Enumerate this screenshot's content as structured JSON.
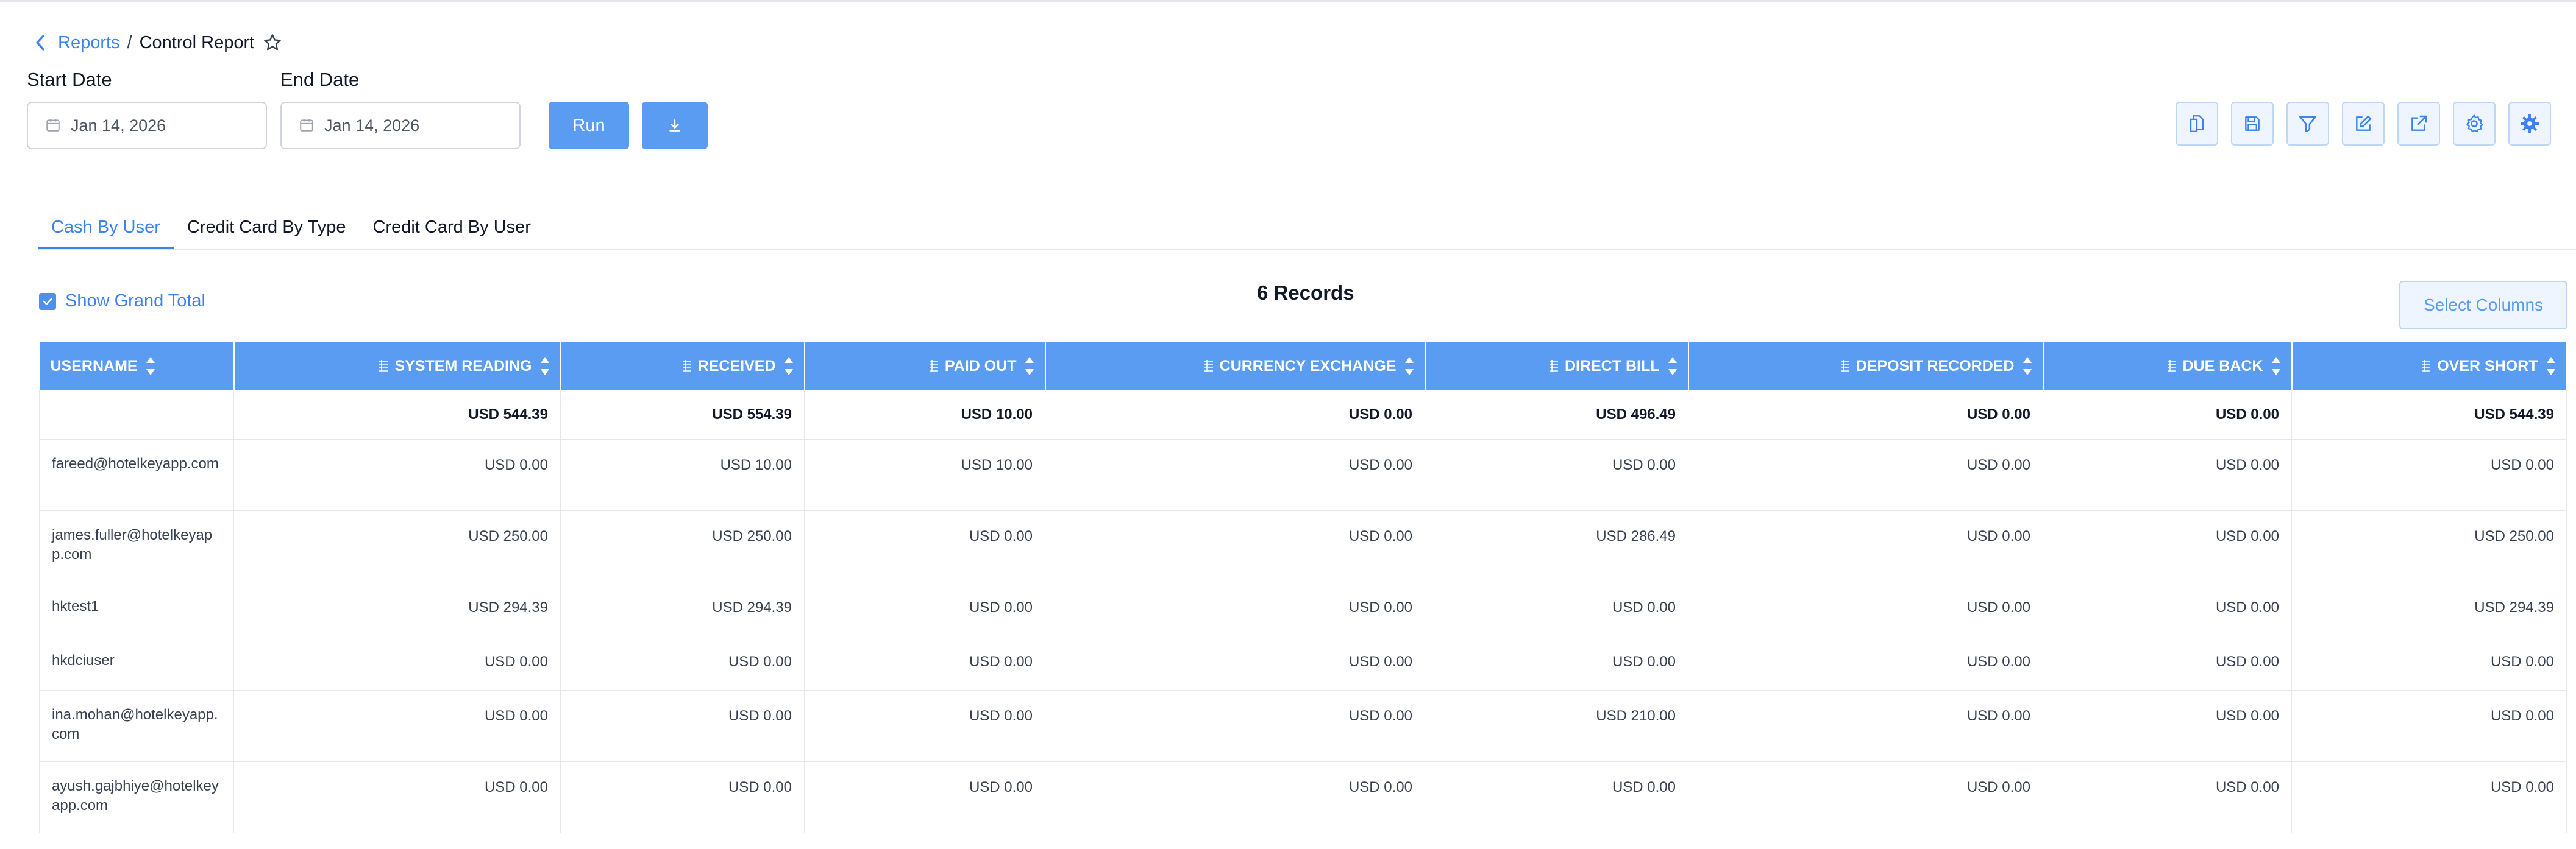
{
  "breadcrumb": {
    "parent": "Reports",
    "separator": "/",
    "current": "Control Report"
  },
  "filters": {
    "start_label": "Start Date",
    "start_value": "Jan 14, 2026",
    "end_label": "End Date",
    "end_value": "Jan 14, 2026",
    "run_label": "Run"
  },
  "toolbar_icons": [
    "export-pdf-icon",
    "save-icon",
    "filter-icon",
    "edit-icon",
    "share-icon",
    "settings-icon",
    "advanced-settings-icon"
  ],
  "tabs": [
    {
      "label": "Cash By User",
      "active": true
    },
    {
      "label": "Credit Card By Type",
      "active": false
    },
    {
      "label": "Credit Card By User",
      "active": false
    }
  ],
  "grand_total": {
    "label": "Show Grand Total",
    "checked": true
  },
  "records_label": "6 Records",
  "select_columns_label": "Select Columns",
  "table": {
    "columns": [
      "USERNAME",
      "SYSTEM READING",
      "RECEIVED",
      "PAID OUT",
      "CURRENCY EXCHANGE",
      "DIRECT BILL",
      "DEPOSIT RECORDED",
      "DUE BACK",
      "OVER SHORT"
    ],
    "totals": [
      "",
      "USD 544.39",
      "USD 554.39",
      "USD 10.00",
      "USD 0.00",
      "USD 496.49",
      "USD 0.00",
      "USD 0.00",
      "USD 544.39"
    ],
    "rows": [
      [
        "fareed@hotelkeyapp.com",
        "USD 0.00",
        "USD 10.00",
        "USD 10.00",
        "USD 0.00",
        "USD 0.00",
        "USD 0.00",
        "USD 0.00",
        "USD 0.00"
      ],
      [
        "james.fuller@hotelkeyapp.com",
        "USD 250.00",
        "USD 250.00",
        "USD 0.00",
        "USD 0.00",
        "USD 286.49",
        "USD 0.00",
        "USD 0.00",
        "USD 250.00"
      ],
      [
        "hktest1",
        "USD 294.39",
        "USD 294.39",
        "USD 0.00",
        "USD 0.00",
        "USD 0.00",
        "USD 0.00",
        "USD 0.00",
        "USD 294.39"
      ],
      [
        "hkdciuser",
        "USD 0.00",
        "USD 0.00",
        "USD 0.00",
        "USD 0.00",
        "USD 0.00",
        "USD 0.00",
        "USD 0.00",
        "USD 0.00"
      ],
      [
        "ina.mohan@hotelkeyapp.com",
        "USD 0.00",
        "USD 0.00",
        "USD 0.00",
        "USD 0.00",
        "USD 210.00",
        "USD 0.00",
        "USD 0.00",
        "USD 0.00"
      ],
      [
        "ayush.gajbhiye@hotelkeyapp.com",
        "USD 0.00",
        "USD 0.00",
        "USD 0.00",
        "USD 0.00",
        "USD 0.00",
        "USD 0.00",
        "USD 0.00",
        "USD 0.00"
      ]
    ]
  },
  "colors": {
    "accent": "#5b9cf3",
    "link": "#3b82f6",
    "border": "#e5e7eb"
  }
}
